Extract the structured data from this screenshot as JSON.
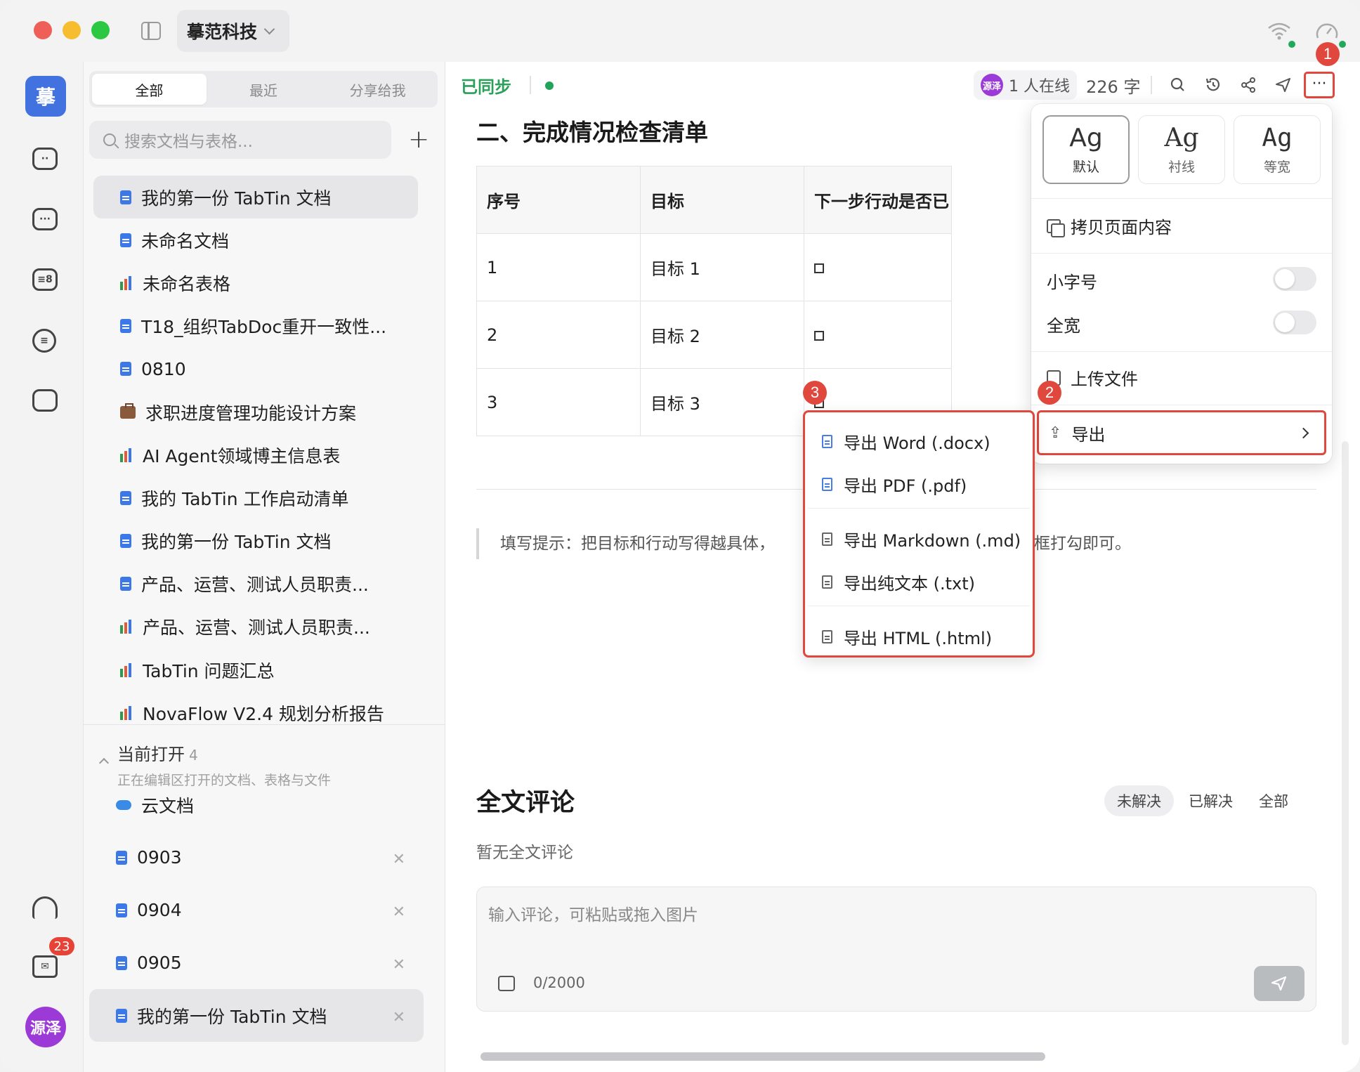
{
  "titlebar": {
    "workspace": "摹范科技",
    "wifi_icon": "wifi-icon",
    "speed_icon": "gauge-icon"
  },
  "rail": {
    "logo": "摹",
    "user_avatar": "源泽",
    "mail_badge": "23",
    "icons": [
      "bot-icon",
      "chat-icon",
      "card-icon",
      "list-icon",
      "folder-icon",
      "headset-icon",
      "mail-icon"
    ]
  },
  "sidebar": {
    "tabs": [
      "全部",
      "最近",
      "分享给我"
    ],
    "search_placeholder": "搜索文档与表格...",
    "add_label": "+",
    "docs": [
      {
        "title": "我的第一份 TabTin 文档",
        "type": "doc"
      },
      {
        "title": "未命名文档",
        "type": "doc"
      },
      {
        "title": "未命名表格",
        "type": "sheet"
      },
      {
        "title": "T18_组织TabDoc重开一致性...",
        "type": "doc"
      },
      {
        "title": "0810",
        "type": "doc"
      },
      {
        "title": "求职进度管理功能设计方案",
        "type": "bag"
      },
      {
        "title": "AI Agent领域博主信息表",
        "type": "sheet"
      },
      {
        "title": "我的 TabTin 工作启动清单",
        "type": "doc"
      },
      {
        "title": "我的第一份 TabTin 文档",
        "type": "doc"
      },
      {
        "title": "产品、运营、测试人员职责...",
        "type": "doc"
      },
      {
        "title": "产品、运营、测试人员职责...",
        "type": "sheet"
      },
      {
        "title": "TabTin 问题汇总",
        "type": "sheet"
      },
      {
        "title": "NovaFlow V2.4 规划分析报告",
        "type": "sheet"
      }
    ],
    "open_section": {
      "title": "当前打开",
      "count": "4",
      "subtitle": "正在编辑区打开的文档、表格与文件",
      "items": [
        {
          "title": "云文档",
          "type": "cloud",
          "closable": false
        },
        {
          "title": "0903",
          "type": "doc",
          "closable": true
        },
        {
          "title": "0904",
          "type": "doc",
          "closable": true
        },
        {
          "title": "0905",
          "type": "doc",
          "closable": true
        },
        {
          "title": "我的第一份 TabTin 文档",
          "type": "doc",
          "closable": true
        }
      ]
    }
  },
  "topbar": {
    "sync_status": "已同步",
    "presence_avatar": "源泽",
    "online_text": "1 人在线",
    "word_count": "226 字",
    "more_label": "···"
  },
  "doc": {
    "heading": "二、完成情况检查清单",
    "table": {
      "headers": [
        "序号",
        "目标",
        "下一步行动是否已"
      ],
      "rows": [
        [
          "1",
          "目标 1",
          ""
        ],
        [
          "2",
          "目标 2",
          ""
        ],
        [
          "3",
          "目标 3",
          ""
        ]
      ]
    },
    "tip_left": "填写提示：把目标和行动写得越具体，",
    "tip_right": "框打勾即可。"
  },
  "comments": {
    "title": "全文评论",
    "filters": [
      "未解决",
      "已解决",
      "全部"
    ],
    "empty": "暂无全文评论",
    "input_placeholder": "输入评论，可粘贴或拖入图片",
    "char_count": "0/2000"
  },
  "popover": {
    "fonts": [
      {
        "glyph": "Ag",
        "label": "默认"
      },
      {
        "glyph": "Ag",
        "label": "衬线"
      },
      {
        "glyph": "Ag",
        "label": "等宽"
      }
    ],
    "copy_label": "拷贝页面内容",
    "small_font_label": "小字号",
    "full_width_label": "全宽",
    "upload_label": "上传文件",
    "export_label": "导出"
  },
  "export_menu": {
    "items": [
      "导出 Word (.docx)",
      "导出 PDF (.pdf)",
      "导出 Markdown (.md)",
      "导出纯文本 (.txt)",
      "导出 HTML (.html)"
    ]
  },
  "steps": [
    "1",
    "2",
    "3"
  ],
  "colors": {
    "accent_blue": "#4272e0",
    "sync_green": "#2aa05a",
    "highlight_red": "#e0473d",
    "avatar_purple": "#9c3ad8"
  }
}
